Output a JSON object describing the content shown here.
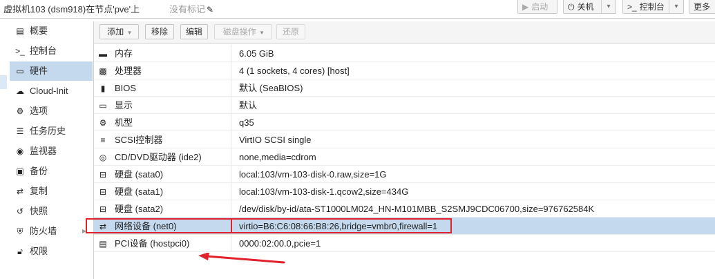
{
  "header": {
    "title": "虚拟机103 (dsm918)在节点'pve'上",
    "tags": "没有标记",
    "buttons": {
      "start": "启动",
      "shutdown": "关机",
      "console": "控制台",
      "more": "更多"
    }
  },
  "sidebar": {
    "items": [
      {
        "label": "概要",
        "icon": "book-icon"
      },
      {
        "label": "控制台",
        "icon": "terminal-icon"
      },
      {
        "label": "硬件",
        "icon": "monitor-icon"
      },
      {
        "label": "Cloud-Init",
        "icon": "cloud-icon"
      },
      {
        "label": "选项",
        "icon": "gear-icon"
      },
      {
        "label": "任务历史",
        "icon": "list-icon"
      },
      {
        "label": "监视器",
        "icon": "eye-icon"
      },
      {
        "label": "备份",
        "icon": "floppy-icon"
      },
      {
        "label": "复制",
        "icon": "retweet-icon"
      },
      {
        "label": "快照",
        "icon": "history-icon"
      },
      {
        "label": "防火墙",
        "icon": "shield-icon"
      },
      {
        "label": "权限",
        "icon": "unlock-icon"
      }
    ],
    "selected": "硬件"
  },
  "toolbar": {
    "add": "添加",
    "remove": "移除",
    "edit": "编辑",
    "disk_action": "磁盘操作",
    "revert": "还原"
  },
  "hardware": {
    "rows": [
      {
        "key": "内存",
        "value": "6.05 GiB",
        "icon": "memory-icon"
      },
      {
        "key": "处理器",
        "value": "4 (1 sockets, 4 cores) [host]",
        "icon": "cpu-icon"
      },
      {
        "key": "BIOS",
        "value": "默认 (SeaBIOS)",
        "icon": "microchip-icon"
      },
      {
        "key": "显示",
        "value": "默认",
        "icon": "desktop-icon"
      },
      {
        "key": "机型",
        "value": "q35",
        "icon": "cogs-icon"
      },
      {
        "key": "SCSI控制器",
        "value": "VirtIO SCSI single",
        "icon": "database-icon"
      },
      {
        "key": "CD/DVD驱动器 (ide2)",
        "value": "none,media=cdrom",
        "icon": "cdrom-icon"
      },
      {
        "key": "硬盘 (sata0)",
        "value": "local:103/vm-103-disk-0.raw,size=1G",
        "icon": "harddisk-icon"
      },
      {
        "key": "硬盘 (sata1)",
        "value": "local:103/vm-103-disk-1.qcow2,size=434G",
        "icon": "harddisk-icon"
      },
      {
        "key": "硬盘 (sata2)",
        "value": "/dev/disk/by-id/ata-ST1000LM024_HN-M101MBB_S2SMJ9CDC06700,size=976762584K",
        "icon": "harddisk-icon"
      },
      {
        "key": "网络设备 (net0)",
        "value": "virtio=B6:C6:08:66:B8:26,bridge=vmbr0,firewall=1",
        "icon": "exchange-icon"
      },
      {
        "key": "PCI设备 (hostpci0)",
        "value": "0000:02:00.0,pcie=1",
        "icon": "pci-card-icon"
      }
    ],
    "selected_index": 10
  },
  "colors": {
    "selection": "#c4d9ee",
    "annotation": "#e0222d"
  }
}
